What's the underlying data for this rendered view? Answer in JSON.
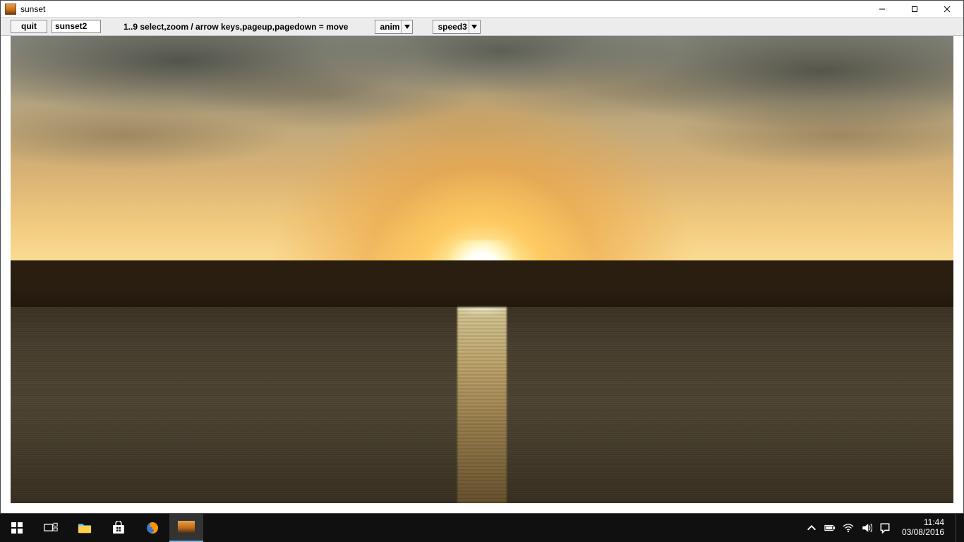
{
  "window": {
    "title": "sunset"
  },
  "toolbar": {
    "quit_label": "quit",
    "image_name": "sunset2",
    "help_text": "1..9 select,zoom / arrow keys,pageup,pagedown = move",
    "anim_select": "anim",
    "speed_select": "speed3"
  },
  "taskbar": {
    "time": "11:44",
    "date": "03/08/2016"
  }
}
